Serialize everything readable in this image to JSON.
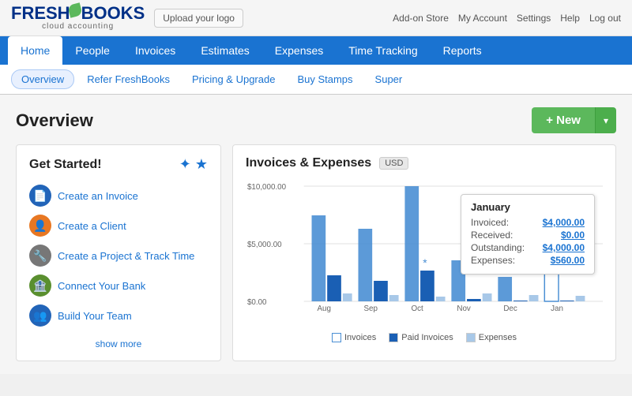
{
  "topBar": {
    "logoFresh": "FRESH",
    "logoBooks": "BOOKS",
    "logoSub": "cloud accounting",
    "uploadLogoBtn": "Upload your logo",
    "navLinks": [
      "Add-on Store",
      "My Account",
      "Settings",
      "Help",
      "Log out"
    ]
  },
  "mainNav": {
    "items": [
      {
        "label": "Home",
        "active": true
      },
      {
        "label": "People",
        "active": false
      },
      {
        "label": "Invoices",
        "active": false
      },
      {
        "label": "Estimates",
        "active": false
      },
      {
        "label": "Expenses",
        "active": false
      },
      {
        "label": "Time Tracking",
        "active": false
      },
      {
        "label": "Reports",
        "active": false
      }
    ]
  },
  "subNav": {
    "items": [
      {
        "label": "Overview",
        "active": true
      },
      {
        "label": "Refer FreshBooks",
        "active": false
      },
      {
        "label": "Pricing & Upgrade",
        "active": false
      },
      {
        "label": "Buy Stamps",
        "active": false
      },
      {
        "label": "Super",
        "active": false
      }
    ]
  },
  "overview": {
    "title": "Overview",
    "newButton": "+ New",
    "dropdownArrow": "▾"
  },
  "getStarted": {
    "title": "Get Started!",
    "starsIcon": "★ ★",
    "actions": [
      {
        "icon": "📄",
        "label": "Create an Invoice"
      },
      {
        "icon": "👤",
        "label": "Create a Client"
      },
      {
        "icon": "🔧",
        "label": "Create a Project & Track Time"
      },
      {
        "icon": "🏦",
        "label": "Connect Your Bank"
      },
      {
        "icon": "👥",
        "label": "Build Your Team"
      }
    ],
    "showMore": "show more"
  },
  "chart": {
    "title": "Invoices & Expenses",
    "currency": "USD",
    "yLabels": [
      "$10,000.00",
      "$5,000.00",
      "$0.00"
    ],
    "xLabels": [
      "Aug",
      "Sep",
      "Oct",
      "Nov",
      "Dec",
      "Jan"
    ],
    "legend": [
      {
        "label": "Invoices",
        "color": "empty"
      },
      {
        "label": "Paid Invoices",
        "color": "blue"
      },
      {
        "label": "Expenses",
        "color": "lightblue"
      }
    ],
    "tooltip": {
      "month": "January",
      "invoicedLabel": "Invoiced:",
      "invoicedValue": "$4,000.00",
      "receivedLabel": "Received:",
      "receivedValue": "$0.00",
      "outstandingLabel": "Outstanding:",
      "outstandingValue": "$4,000.00",
      "expensesLabel": "Expenses:",
      "expensesValue": "$560.00"
    }
  }
}
